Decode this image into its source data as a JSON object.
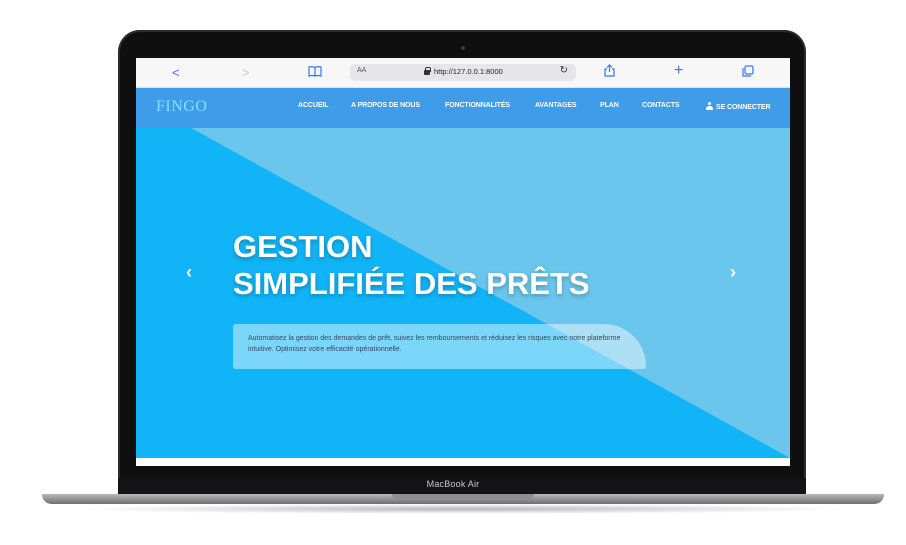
{
  "device": {
    "label": "MacBook Air"
  },
  "browser": {
    "back_icon": "chevron-left-icon",
    "forward_icon": "chevron-right-icon",
    "bookmarks_icon": "book-icon",
    "text_size": "AA",
    "url": "http://127.0.0.1:8000",
    "reload_icon": "reload-icon",
    "share_icon": "share-icon",
    "new_tab_icon": "plus-icon",
    "tabs_icon": "tabs-icon"
  },
  "site": {
    "brand": "FINGO",
    "nav": [
      {
        "label": "ACCUEIL"
      },
      {
        "label": "A PROPOS DE NOUS"
      },
      {
        "label": "FONCTIONNALITÉS"
      },
      {
        "label": "AVANTAGES"
      },
      {
        "label": "PLAN"
      },
      {
        "label": "CONTACTS"
      },
      {
        "label": "SE CONNECTER"
      }
    ],
    "hero": {
      "title_line1": "GESTION",
      "title_line2": "SIMPLIFIÉE DES PRÊTS",
      "description": "Automatisez la gestion des demandes de prêt, suivez les remboursements et réduisez les risques avec notre plateforme intuitive. Optimisez votre efficacité opérationnelle.",
      "prev_arrow": "‹",
      "next_arrow": "›"
    }
  },
  "colors": {
    "nav_bg": "#3f9ce8",
    "hero_bg": "#11b4f6",
    "hero_diag": "#6ac6ec",
    "brand": "#7fe3ff"
  }
}
